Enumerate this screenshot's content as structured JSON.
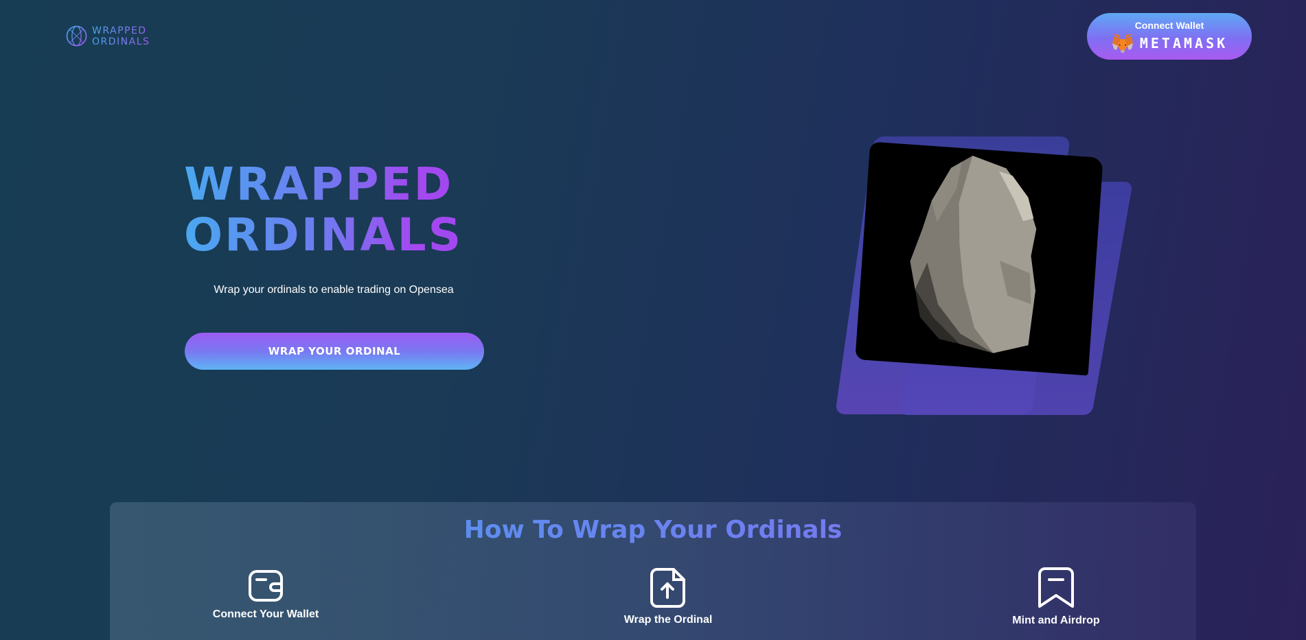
{
  "header": {
    "logo_line1": "WRAPPED",
    "logo_line2": "ORDINALS",
    "connect_label": "Connect Wallet",
    "wallet_name": "METAMASK"
  },
  "hero": {
    "title_line1": "WRAPPED",
    "title_line2": "ORDINALS",
    "subtitle": "Wrap your ordinals to enable trading on Opensea",
    "cta_label": "WRAP YOUR ORDINAL"
  },
  "how_to": {
    "title": "How To Wrap Your Ordinals",
    "steps": [
      {
        "label": "Connect Your Wallet",
        "icon": "wallet-icon"
      },
      {
        "label": "Wrap the Ordinal",
        "icon": "file-upload-icon"
      },
      {
        "label": "Mint and Airdrop",
        "icon": "bookmark-icon"
      }
    ]
  },
  "colors": {
    "accent_blue": "#4aa8f0",
    "accent_purple": "#a448f0",
    "background_start": "#173d54",
    "background_end": "#2a2158"
  }
}
